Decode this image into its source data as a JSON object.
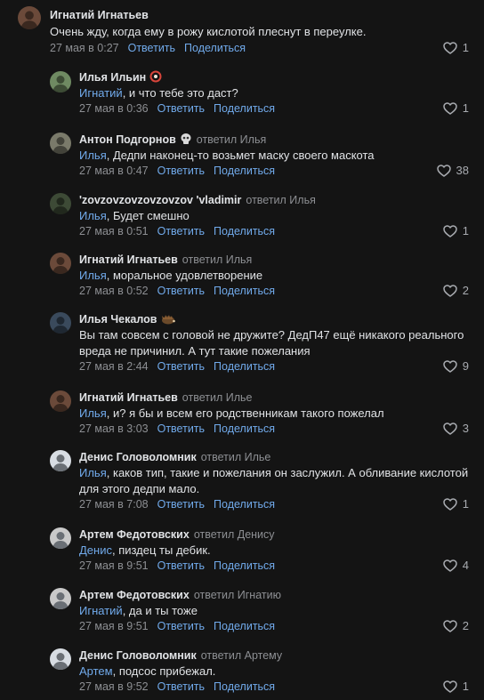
{
  "thread": {
    "comments": [
      {
        "author": "Игнатий Игнатьев",
        "badge": null,
        "replied_to": "",
        "mention": "",
        "text": "Очень жду, когда ему в рожу кислотой плеснут в переулке.",
        "time": "27 мая в 0:27",
        "reply_label": "Ответить",
        "share_label": "Поделиться",
        "likes": "1",
        "avatar_color": "#6b4a3a",
        "level": "top"
      },
      {
        "author": "Илья Ильин",
        "badge": "red-ring-badge",
        "replied_to": "",
        "mention": "Игнатий",
        "text": ", и что тебе это даст?",
        "time": "27 мая в 0:36",
        "reply_label": "Ответить",
        "share_label": "Поделиться",
        "likes": "1",
        "avatar_color": "#6f8a62",
        "level": "reply"
      },
      {
        "author": "Антон Подгорнов",
        "badge": "skull-badge",
        "replied_to": "ответил Илья",
        "mention": "Илья",
        "text": ", Дедпи наконец-то возьмет маску своего маскота",
        "time": "27 мая в 0:47",
        "reply_label": "Ответить",
        "share_label": "Поделиться",
        "likes": "38",
        "avatar_color": "#7a7a6a",
        "level": "reply"
      },
      {
        "author": "'zovzovzovzovzovzov 'vladimir",
        "badge": null,
        "replied_to": "ответил Илья",
        "mention": "Илья",
        "text": ", Будет смешно",
        "time": "27 мая в 0:51",
        "reply_label": "Ответить",
        "share_label": "Поделиться",
        "likes": "1",
        "avatar_color": "#3d4a36",
        "level": "reply"
      },
      {
        "author": "Игнатий Игнатьев",
        "badge": null,
        "replied_to": "ответил Илья",
        "mention": "Илья",
        "text": ", моральное удовлетворение",
        "time": "27 мая в 0:52",
        "reply_label": "Ответить",
        "share_label": "Поделиться",
        "likes": "2",
        "avatar_color": "#6b4a3a",
        "level": "reply"
      },
      {
        "author": "Илья Чекалов",
        "badge": "hedgehog-badge",
        "replied_to": "",
        "mention": "",
        "text": "Вы там совсем с головой не дружите? ДедП47 ещё никакого реального вреда не причинил. А тут такие пожелания",
        "time": "27 мая в 2:44",
        "reply_label": "Ответить",
        "share_label": "Поделиться",
        "likes": "9",
        "avatar_color": "#3a4a5c",
        "level": "reply"
      },
      {
        "author": "Игнатий Игнатьев",
        "badge": null,
        "replied_to": "ответил Илье",
        "mention": "Илья",
        "text": ", и? я бы и всем его родственникам такого пожелал",
        "time": "27 мая в 3:03",
        "reply_label": "Ответить",
        "share_label": "Поделиться",
        "likes": "3",
        "avatar_color": "#6b4a3a",
        "level": "reply"
      },
      {
        "author": "Денис Головоломник",
        "badge": null,
        "replied_to": "ответил Илье",
        "mention": "Илья",
        "text": ", каков тип, такие и пожелания он заслужил. А обливание кислотой для этого дедпи мало.",
        "time": "27 мая в 7:08",
        "reply_label": "Ответить",
        "share_label": "Поделиться",
        "likes": "1",
        "avatar_color": "#d8dde3",
        "level": "reply"
      },
      {
        "author": "Артем Федотовских",
        "badge": null,
        "replied_to": "ответил Денису",
        "mention": "Денис",
        "text": ", пиздец ты дебик.",
        "time": "27 мая в 9:51",
        "reply_label": "Ответить",
        "share_label": "Поделиться",
        "likes": "4",
        "avatar_color": "#c9c9c9",
        "level": "reply"
      },
      {
        "author": "Артем Федотовских",
        "badge": null,
        "replied_to": "ответил Игнатию",
        "mention": "Игнатий",
        "text": ", да и ты тоже",
        "time": "27 мая в 9:51",
        "reply_label": "Ответить",
        "share_label": "Поделиться",
        "likes": "2",
        "avatar_color": "#c9c9c9",
        "level": "reply"
      },
      {
        "author": "Денис Головоломник",
        "badge": null,
        "replied_to": "ответил Артему",
        "mention": "Артем",
        "text": ", подсос прибежал.",
        "time": "27 мая в 9:52",
        "reply_label": "Ответить",
        "share_label": "Поделиться",
        "likes": "1",
        "avatar_color": "#d8dde3",
        "level": "reply"
      }
    ]
  }
}
